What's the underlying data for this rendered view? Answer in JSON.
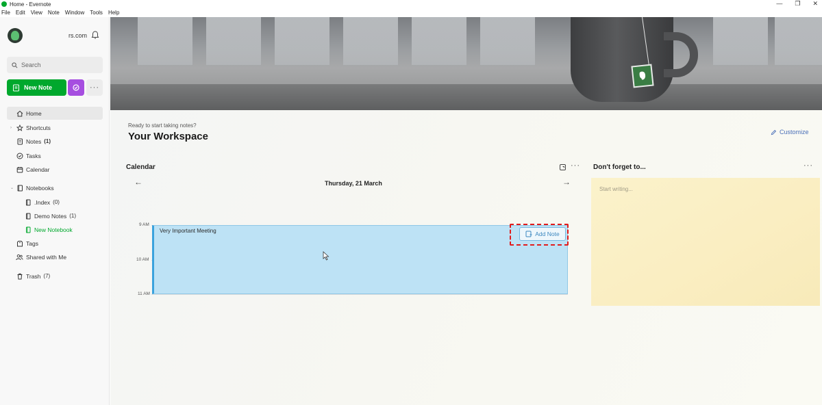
{
  "window": {
    "title": "Home - Evernote"
  },
  "menu": [
    "File",
    "Edit",
    "View",
    "Note",
    "Window",
    "Tools",
    "Help"
  ],
  "sidebar": {
    "account": "rs.com",
    "search_placeholder": "Search",
    "new_note": "New Note",
    "items": [
      {
        "label": "Home"
      },
      {
        "label": "Shortcuts"
      },
      {
        "label": "Notes",
        "count": "(1)"
      },
      {
        "label": "Tasks"
      },
      {
        "label": "Calendar"
      },
      {
        "label": "Notebooks"
      },
      {
        "label": ".Index",
        "count": "(0)"
      },
      {
        "label": "Demo Notes",
        "count": "(1)"
      },
      {
        "label": "New Notebook"
      },
      {
        "label": "Tags"
      },
      {
        "label": "Shared with Me"
      },
      {
        "label": "Trash",
        "count": "(7)"
      }
    ]
  },
  "main": {
    "subtitle": "Ready to start taking notes?",
    "title": "Your Workspace",
    "customize": "Customize",
    "calendar": {
      "title": "Calendar",
      "date": "Thursday, 21 March",
      "hours": [
        "9 AM",
        "10 AM",
        "11 AM"
      ],
      "event": {
        "title": "Very Important Meeting",
        "action": "Add Note"
      }
    },
    "widget": {
      "title": "Don't forget to...",
      "placeholder": "Start writing..."
    }
  },
  "colors": {
    "accent_green": "#00a82d",
    "ai_purple": "#a64ee0",
    "event_blue": "#bde2f5",
    "highlight_red": "#e21b1b",
    "sticky_yellow": "#faeec2"
  }
}
